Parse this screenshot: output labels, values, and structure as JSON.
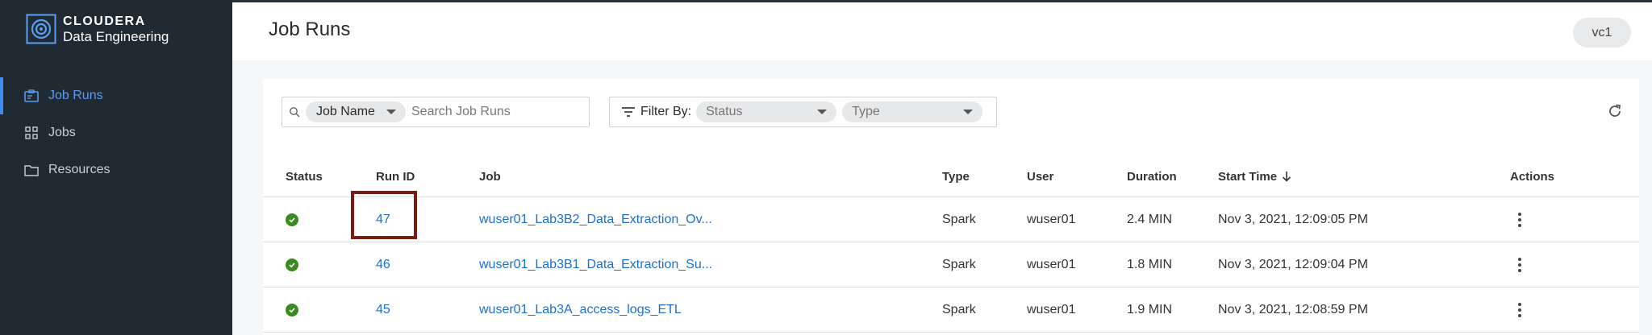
{
  "app": {
    "brand_name": "CLOUDERA",
    "product": "Data Engineering",
    "accent": "#3f8df3"
  },
  "sidebar": {
    "items": [
      {
        "label": "Job Runs",
        "icon": "job-runs-icon",
        "active": true
      },
      {
        "label": "Jobs",
        "icon": "grid-icon",
        "active": false
      },
      {
        "label": "Resources",
        "icon": "folder-icon",
        "active": false
      }
    ]
  },
  "header": {
    "title": "Job Runs",
    "vc_badge": "vc1"
  },
  "toolbar": {
    "search_field": "Job Name",
    "search_placeholder": "Search Job Runs",
    "filter_label": "Filter By:",
    "status_placeholder": "Status",
    "type_placeholder": "Type"
  },
  "table": {
    "headers": {
      "status": "Status",
      "run_id": "Run ID",
      "job": "Job",
      "type": "Type",
      "user": "User",
      "duration": "Duration",
      "start_time": "Start Time",
      "actions": "Actions"
    },
    "sort": {
      "column": "start_time",
      "direction": "desc"
    },
    "rows": [
      {
        "status": "success",
        "run_id": "47",
        "job": "wuser01_Lab3B2_Data_Extraction_Ov...",
        "type": "Spark",
        "user": "wuser01",
        "duration": "2.4 MIN",
        "start_time": "Nov 3, 2021, 12:09:05 PM"
      },
      {
        "status": "success",
        "run_id": "46",
        "job": "wuser01_Lab3B1_Data_Extraction_Su...",
        "type": "Spark",
        "user": "wuser01",
        "duration": "1.8 MIN",
        "start_time": "Nov 3, 2021, 12:09:04 PM"
      },
      {
        "status": "success",
        "run_id": "45",
        "job": "wuser01_Lab3A_access_logs_ETL",
        "type": "Spark",
        "user": "wuser01",
        "duration": "1.9 MIN",
        "start_time": "Nov 3, 2021, 12:08:59 PM"
      }
    ]
  },
  "colors": {
    "sidebar_bg": "#1f2a33",
    "link": "#1e6fcf",
    "success": "#3a8a1f",
    "highlight": "#7a1a12"
  }
}
